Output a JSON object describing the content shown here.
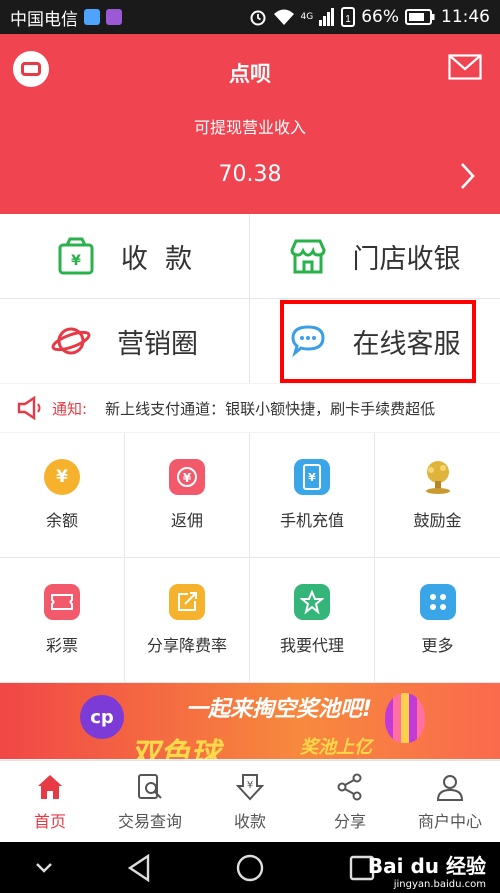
{
  "status_bar": {
    "carrier": "中国电信",
    "signal": "4G",
    "battery": "66%",
    "time": "11:46"
  },
  "header": {
    "title": "点呗",
    "subtitle": "可提现营业收入",
    "amount": "70.38"
  },
  "main_grid": [
    {
      "label": "收  款",
      "icon": "wallet-icon",
      "color": "#2ab24a"
    },
    {
      "label": "门店收银",
      "icon": "store-icon",
      "color": "#2ab24a"
    },
    {
      "label": "营销圈",
      "icon": "planet-icon",
      "color": "#e83a44"
    },
    {
      "label": "在线客服",
      "icon": "chat-icon",
      "color": "#3a9fe6"
    }
  ],
  "notice": {
    "label": "通知:",
    "text": "新上线支付通道：银联小额快捷，刷卡手续费超低"
  },
  "features": [
    {
      "label": "余额",
      "icon": "moneybag-icon",
      "color": "#f6b22c",
      "glyph": "¥"
    },
    {
      "label": "返佣",
      "icon": "coin-icon",
      "color": "#f25a6b",
      "glyph": "¥"
    },
    {
      "label": "手机充值",
      "icon": "phone-icon",
      "color": "#3aa6e8",
      "glyph": "¥"
    },
    {
      "label": "鼓励金",
      "icon": "tree-icon",
      "color": "#d8a72c",
      "glyph": ""
    },
    {
      "label": "彩票",
      "icon": "ticket-icon",
      "color": "#f25a6b",
      "glyph": ""
    },
    {
      "label": "分享降费率",
      "icon": "share-square-icon",
      "color": "#f6b22c",
      "glyph": ""
    },
    {
      "label": "我要代理",
      "icon": "agent-icon",
      "color": "#34b57a",
      "glyph": ""
    },
    {
      "label": "更多",
      "icon": "grid-icon",
      "color": "#3aa6e8",
      "glyph": ""
    }
  ],
  "banner": {
    "text1": "一起来掏空奖池吧!",
    "text2": "双色球",
    "text3": "奖池上亿"
  },
  "tabs": [
    {
      "label": "首页",
      "icon": "home-icon",
      "active": true
    },
    {
      "label": "交易查询",
      "icon": "search-doc-icon",
      "active": false
    },
    {
      "label": "收款",
      "icon": "receive-icon",
      "active": false
    },
    {
      "label": "分享",
      "icon": "share-icon",
      "active": false
    },
    {
      "label": "商户中心",
      "icon": "user-icon",
      "active": false
    }
  ],
  "watermark": {
    "brand": "Bai du 经验",
    "url": "jingyan.baidu.com"
  }
}
